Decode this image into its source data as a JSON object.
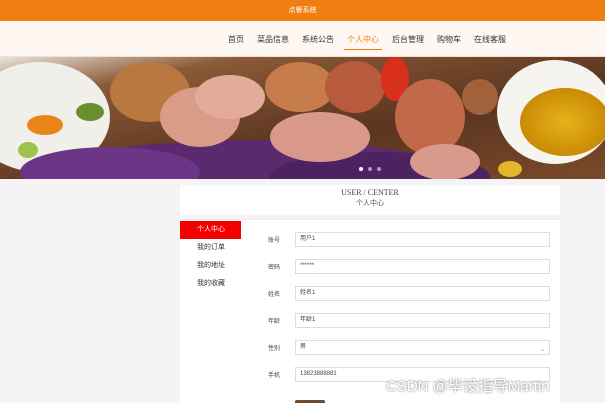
{
  "topbar": {
    "title": "点餐系统"
  },
  "nav": {
    "items": [
      {
        "label": "首页"
      },
      {
        "label": "菜品信息"
      },
      {
        "label": "系统公告"
      },
      {
        "label": "个人中心"
      },
      {
        "label": "后台管理"
      },
      {
        "label": "购物车"
      },
      {
        "label": "在线客服"
      }
    ],
    "active_index": 3
  },
  "banner": {
    "slides": 3,
    "active_slide": 0
  },
  "section": {
    "title_en": "USER / CENTER",
    "title_cn": "个人中心"
  },
  "sidebar": {
    "items": [
      {
        "label": "个人中心"
      },
      {
        "label": "我的订单"
      },
      {
        "label": "我的地址"
      },
      {
        "label": "我的收藏"
      }
    ],
    "active_index": 0
  },
  "form": {
    "fields": [
      {
        "label": "账号",
        "value": "用户1"
      },
      {
        "label": "密码",
        "value": "******"
      },
      {
        "label": "姓名",
        "value": "姓名1"
      },
      {
        "label": "年龄",
        "value": "年龄1"
      },
      {
        "label": "性别",
        "value": "男",
        "type": "select"
      },
      {
        "label": "手机",
        "value": "13823888881"
      }
    ]
  },
  "watermark": {
    "text": "CSDN @毕设指导Martin"
  },
  "colors": {
    "accent": "#f07f12",
    "sidebar_active": "#f40000"
  }
}
